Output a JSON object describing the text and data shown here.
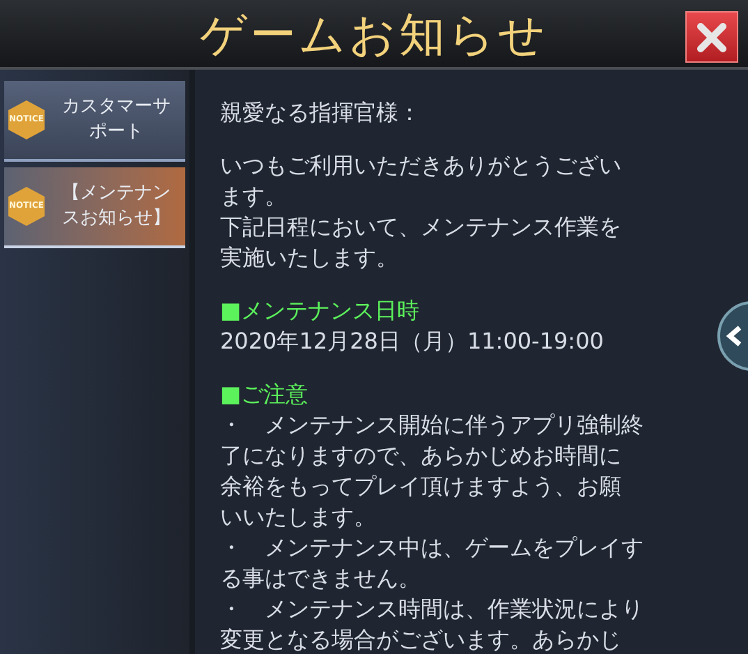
{
  "window": {
    "title": "ゲームお知らせ"
  },
  "sidebar": {
    "items": [
      {
        "badge": "NOTICE",
        "lines": [
          "カスタマーサ",
          "ポート"
        ],
        "selected": false
      },
      {
        "badge": "NOTICE",
        "lines": [
          "【メンテナン",
          "スお知らせ】"
        ],
        "selected": true
      }
    ]
  },
  "content": {
    "sections": [
      [
        {
          "kind": "text",
          "text": "親愛なる指揮官様："
        }
      ],
      [
        {
          "kind": "text",
          "text": "いつもご利用いただきありがとうござい"
        },
        {
          "kind": "text",
          "text": "ます。"
        },
        {
          "kind": "text",
          "text": "下記日程において、メンテナンス作業を"
        },
        {
          "kind": "text",
          "text": "実施いたします。"
        }
      ],
      [
        {
          "kind": "heading",
          "text": "■メンテナンス日時"
        },
        {
          "kind": "text",
          "text": "2020年12月28日（月）11:00-19:00"
        }
      ],
      [
        {
          "kind": "heading",
          "text": "■ご注意"
        },
        {
          "kind": "text",
          "text": "・　メンテナンス開始に伴うアプリ強制終"
        },
        {
          "kind": "text",
          "text": "了になりますので、あらかじめお時間に"
        },
        {
          "kind": "text",
          "text": "余裕をもってプレイ頂けますよう、お願"
        },
        {
          "kind": "text",
          "text": "いいたします。"
        },
        {
          "kind": "text",
          "text": "・　メンテナンス中は、ゲームをプレイす"
        },
        {
          "kind": "text",
          "text": "る事はできません。"
        },
        {
          "kind": "text",
          "text": "・　メンテナンス時間は、作業状況により"
        },
        {
          "kind": "text",
          "text": "変更となる場合がございます。あらかじ"
        }
      ]
    ]
  }
}
